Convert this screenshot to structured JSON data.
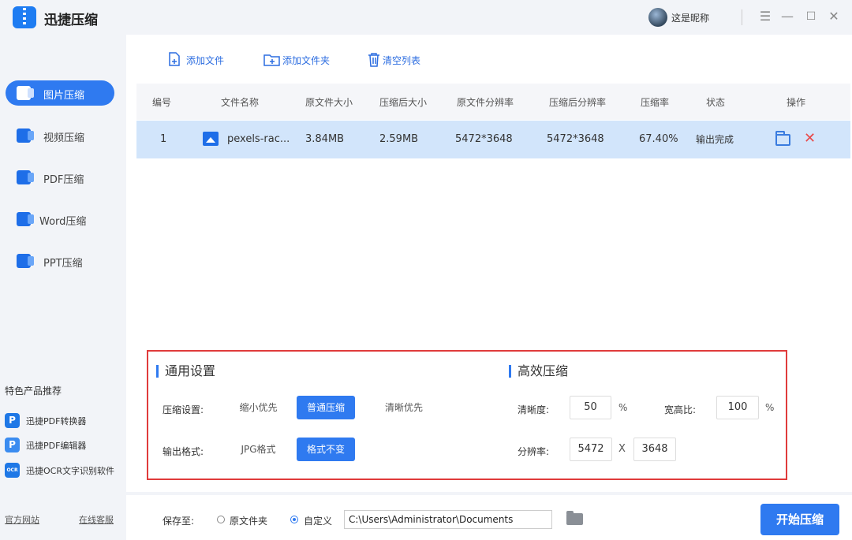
{
  "app": {
    "name": "迅捷压缩",
    "user": "这是昵称"
  },
  "window_controls": [
    "menu-icon",
    "minimize-icon",
    "maximize-icon",
    "close-icon"
  ],
  "sidebar": {
    "items": [
      {
        "label": "图片压缩",
        "icon": "image-compress-icon",
        "active": true
      },
      {
        "label": "视频压缩",
        "icon": "video-compress-icon",
        "active": false
      },
      {
        "label": "PDF压缩",
        "icon": "pdf-compress-icon",
        "active": false
      },
      {
        "label": "Word压缩",
        "icon": "word-compress-icon",
        "active": false
      },
      {
        "label": "PPT压缩",
        "icon": "ppt-compress-icon",
        "active": false
      }
    ],
    "promo_title": "特色产品推荐",
    "promo_items": [
      {
        "label": "迅捷PDF转换器",
        "icon_text": "P"
      },
      {
        "label": "迅捷PDF编辑器",
        "icon_text": "P"
      },
      {
        "label": "迅捷OCR文字识别软件",
        "icon_text": "OCR"
      }
    ],
    "footer": {
      "website": "官方网站",
      "support": "在线客服"
    }
  },
  "toolbar": {
    "add_file": "添加文件",
    "add_folder": "添加文件夹",
    "clear_list": "清空列表"
  },
  "table": {
    "headers": [
      "编号",
      "文件名称",
      "原文件大小",
      "压缩后大小",
      "原文件分辨率",
      "压缩后分辨率",
      "压缩率",
      "状态",
      "操作"
    ],
    "rows": [
      {
        "index": "1",
        "name": "pexels-rac...",
        "orig_size": "3.84MB",
        "comp_size": "2.59MB",
        "orig_res": "5472*3648",
        "comp_res": "5472*3648",
        "ratio": "67.40%",
        "status": "输出完成"
      }
    ]
  },
  "settings": {
    "general_title": "通用设置",
    "compress_label": "压缩设置:",
    "compress_options": [
      "缩小优先",
      "普通压缩",
      "清晰优先"
    ],
    "compress_selected": "普通压缩",
    "format_label": "输出格式:",
    "format_options": [
      "JPG格式",
      "格式不变"
    ],
    "format_selected": "格式不变",
    "efficient_title": "高效压缩",
    "clarity_label": "清晰度:",
    "clarity_value": "50",
    "clarity_unit": "%",
    "aspect_label": "宽高比:",
    "aspect_value": "100",
    "aspect_unit": "%",
    "resolution_label": "分辨率:",
    "res_width": "5472",
    "res_x": "X",
    "res_height": "3648"
  },
  "bottom": {
    "save_to": "保存至:",
    "option_original": "原文件夹",
    "option_custom": "自定义",
    "selected": "自定义",
    "path": "C:\\Users\\Administrator\\Documents",
    "start": "开始压缩"
  },
  "colors": {
    "accent": "#2f7af0",
    "row_selected": "#d2e5fb",
    "delete": "#e84a4a",
    "frame": "#e03b3b"
  }
}
